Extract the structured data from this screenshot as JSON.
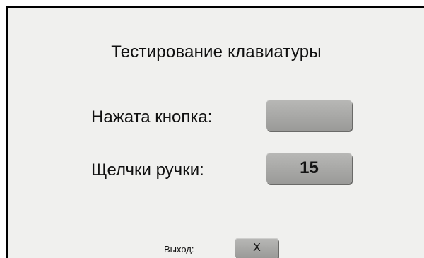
{
  "screen": {
    "title": "Тестирование клавиатуры"
  },
  "pressed_key": {
    "label": "Нажата кнопка:",
    "value": ""
  },
  "knob_clicks": {
    "label": "Щелчки ручки:",
    "value": "15"
  },
  "exit": {
    "label": "Выход:",
    "button_text": "X"
  },
  "colors": {
    "background": "#f0f0ee",
    "button_gray": "#a9a9a7",
    "text": "#101010"
  }
}
